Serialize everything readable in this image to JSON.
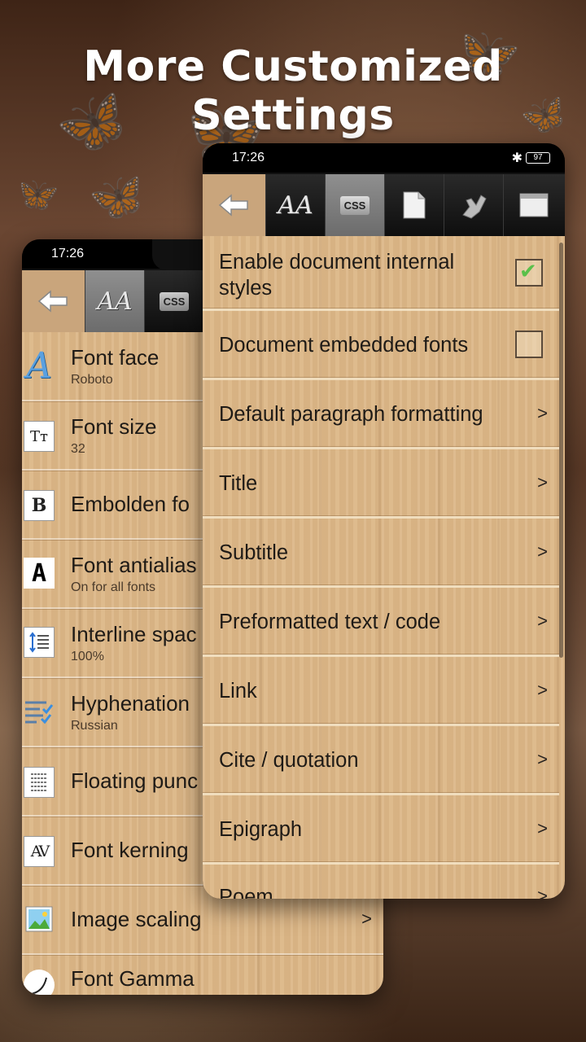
{
  "headline": "More Customized Settings",
  "back_phone": {
    "time": "17:26",
    "toolbar": {
      "back_icon": "back-arrow-icon",
      "tabs": [
        {
          "icon": "font-aa-icon",
          "active": true
        },
        {
          "icon": "css-icon",
          "label": "CSS",
          "active": false
        }
      ]
    },
    "items": [
      {
        "icon": "font-face-icon",
        "title": "Font face",
        "subtitle": "Roboto"
      },
      {
        "icon": "font-size-icon",
        "title": "Font size",
        "subtitle": "32"
      },
      {
        "icon": "bold-icon",
        "title": "Embolden fo",
        "subtitle": ""
      },
      {
        "icon": "antialias-icon",
        "title": "Font antialias",
        "subtitle": "On for all fonts"
      },
      {
        "icon": "line-spacing-icon",
        "title": "Interline spac",
        "subtitle": "100%"
      },
      {
        "icon": "hyphenation-icon",
        "title": "Hyphenation",
        "subtitle": "Russian"
      },
      {
        "icon": "floating-punctuation-icon",
        "title": "Floating punc",
        "subtitle": ""
      },
      {
        "icon": "kerning-icon",
        "title": "Font kerning",
        "subtitle": ""
      },
      {
        "icon": "image-scaling-icon",
        "title": "Image scaling",
        "subtitle": ""
      },
      {
        "icon": "gamma-icon",
        "title": "Font Gamma",
        "subtitle": ""
      }
    ],
    "chevron": ">"
  },
  "front_phone": {
    "time": "17:26",
    "battery": "97",
    "bluetooth_icon": "bluetooth-icon",
    "toolbar": {
      "back_icon": "back-arrow-icon",
      "tabs": [
        {
          "icon": "font-aa-icon",
          "active": false
        },
        {
          "icon": "css-icon",
          "label": "CSS",
          "active": true
        },
        {
          "icon": "page-icon",
          "active": false
        },
        {
          "icon": "tap-gesture-icon",
          "active": false
        },
        {
          "icon": "window-icon",
          "active": false
        }
      ]
    },
    "rows": [
      {
        "label_line1": "Enable document internal",
        "label_line2": "styles",
        "control": "checkbox",
        "checked": true
      },
      {
        "label": "Document embedded fonts",
        "control": "checkbox",
        "checked": false
      },
      {
        "label": "Default paragraph formatting",
        "control": "chevron"
      },
      {
        "label": "Title",
        "control": "chevron"
      },
      {
        "label": "Subtitle",
        "control": "chevron"
      },
      {
        "label": "Preformatted text / code",
        "control": "chevron"
      },
      {
        "label": "Link",
        "control": "chevron"
      },
      {
        "label": "Cite / quotation",
        "control": "chevron"
      },
      {
        "label": "Epigraph",
        "control": "chevron"
      },
      {
        "label": "Poem",
        "control": "chevron"
      }
    ],
    "chevron": ">",
    "check_mark": "✔"
  }
}
